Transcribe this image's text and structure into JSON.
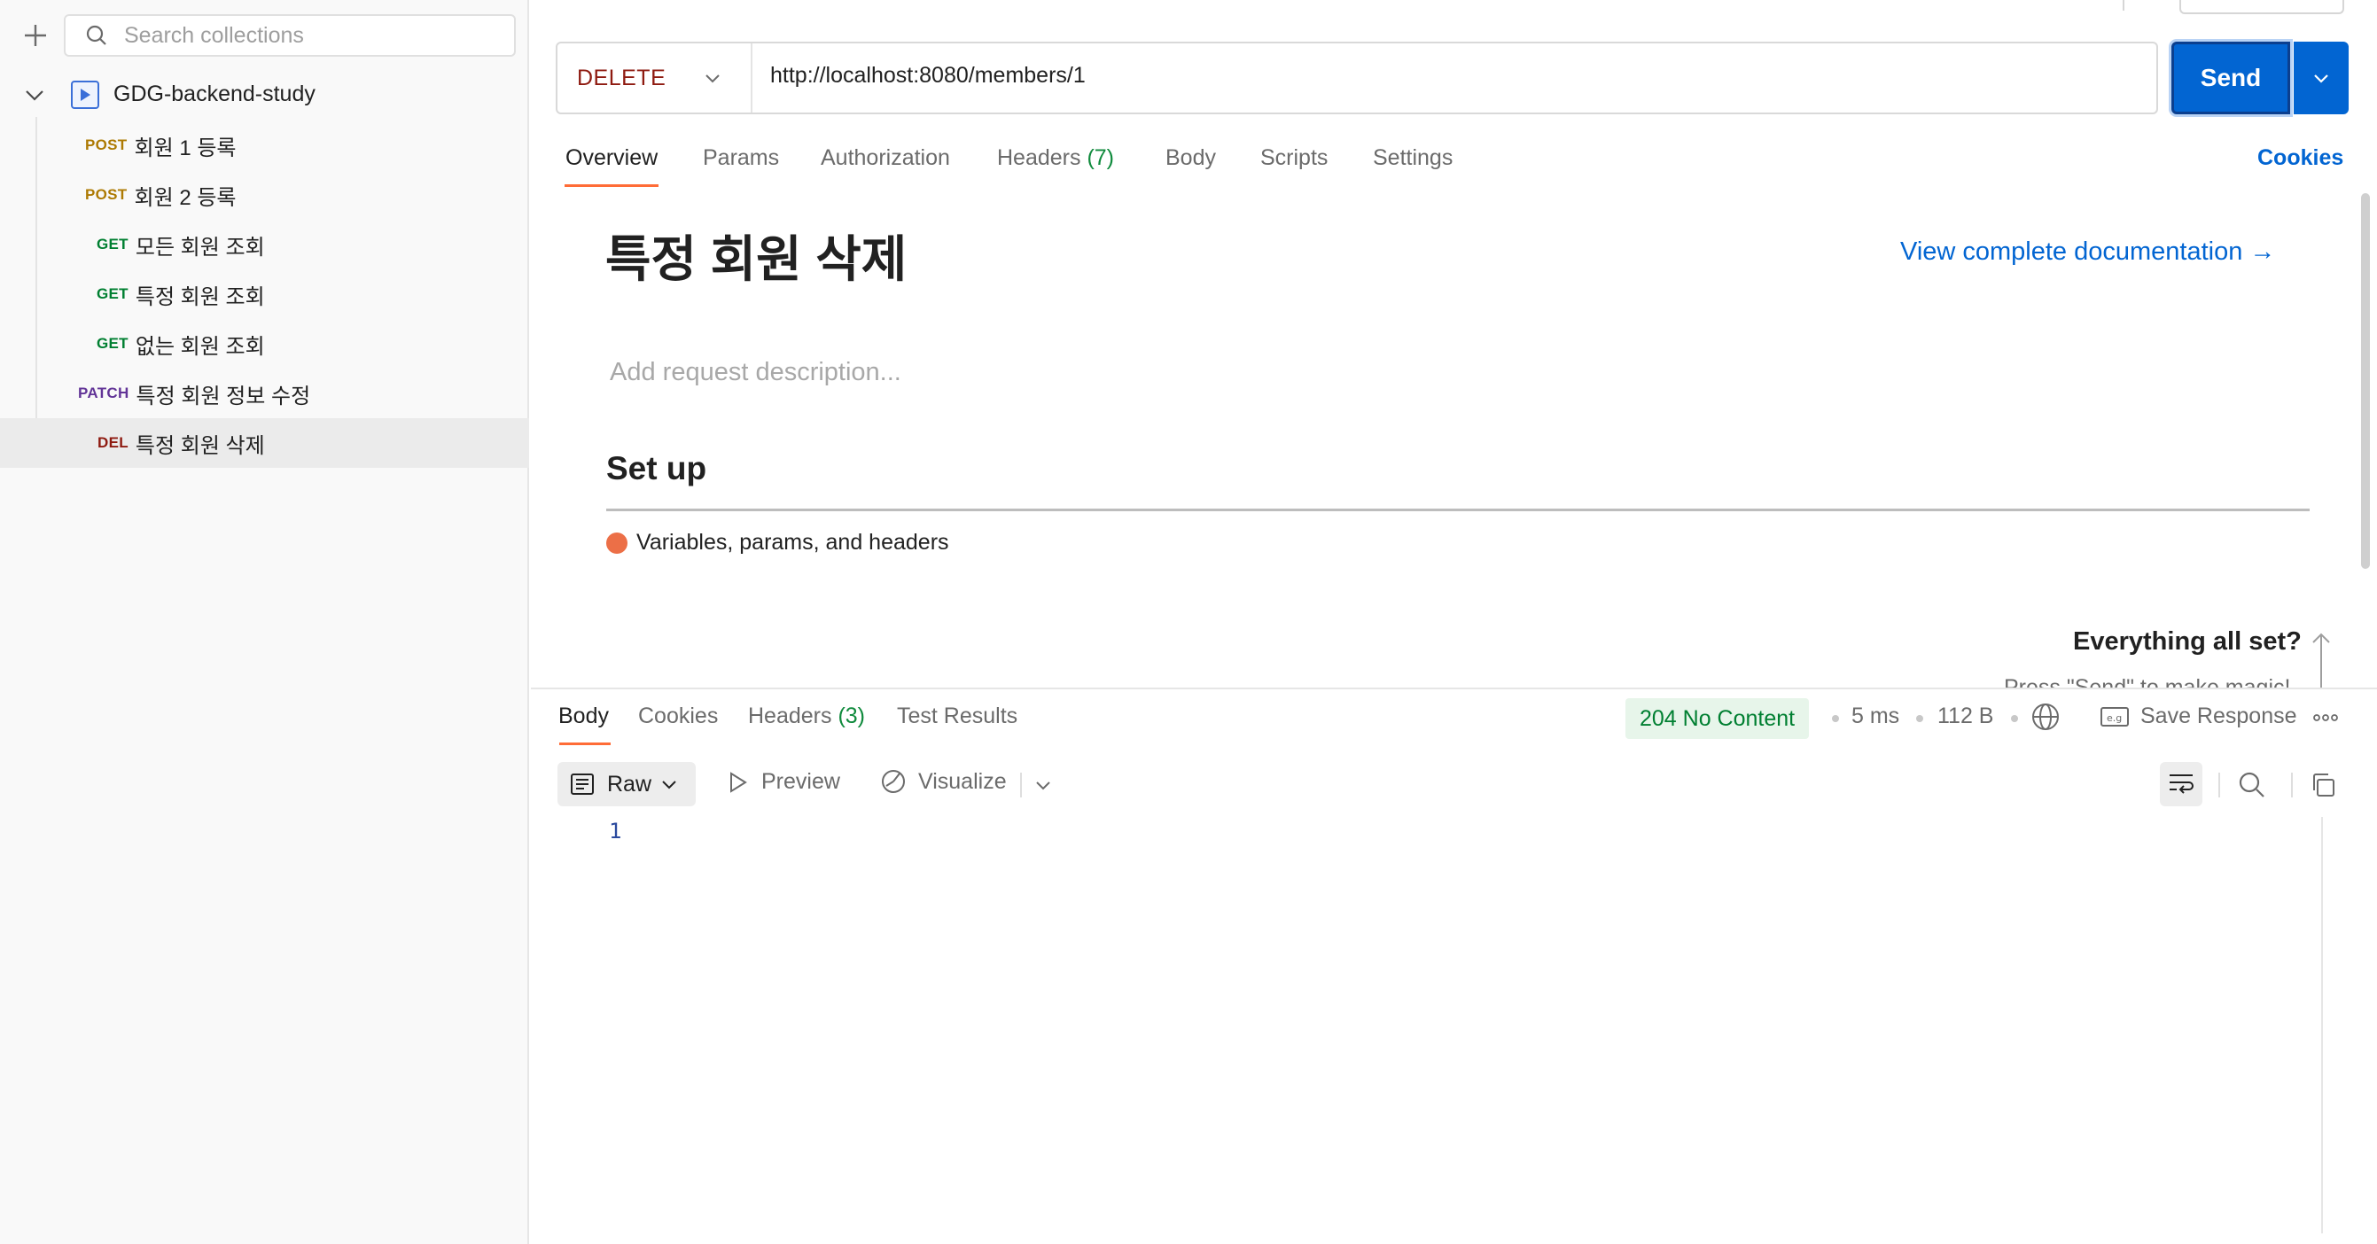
{
  "sidebar": {
    "search_placeholder": "Search collections",
    "collection_name": "GDG-backend-study",
    "requests": [
      {
        "method": "POST",
        "name": "회원 1 등록"
      },
      {
        "method": "POST",
        "name": "회원 2 등록"
      },
      {
        "method": "GET",
        "name": "모든 회원 조회"
      },
      {
        "method": "GET",
        "name": "특정 회원 조회"
      },
      {
        "method": "GET",
        "name": "없는 회원 조회"
      },
      {
        "method": "PATCH",
        "name": "특정 회원 정보 수정"
      },
      {
        "method": "DEL",
        "name": "특정 회원 삭제"
      }
    ]
  },
  "request": {
    "method": "DELETE",
    "url": "http://localhost:8080/members/1",
    "send_label": "Send"
  },
  "tabs": {
    "overview": "Overview",
    "params": "Params",
    "authorization": "Authorization",
    "headers": "Headers",
    "headers_count": "(7)",
    "body": "Body",
    "scripts": "Scripts",
    "settings": "Settings",
    "cookies": "Cookies"
  },
  "doc": {
    "title": "특정 회원 삭제",
    "view_docs": "View complete documentation →",
    "description_placeholder": "Add request description...",
    "setup_title": "Set up",
    "setup_item": "Variables, params, and headers",
    "all_set": "Everything all set?",
    "press_send": "Press \"Send\" to make magic!"
  },
  "response": {
    "tabs": {
      "body": "Body",
      "cookies": "Cookies",
      "headers": "Headers",
      "headers_count": "(3)",
      "test_results": "Test Results"
    },
    "status": "204 No Content",
    "time": "5 ms",
    "size": "112 B",
    "save_response": "Save Response",
    "format": "Raw",
    "preview": "Preview",
    "visualize": "Visualize",
    "line_number": "1"
  },
  "colors": {
    "accent": "#ff6c37",
    "send": "#0265d2",
    "delete": "#8e1a10",
    "get": "#007f31",
    "post": "#ad7a03",
    "patch": "#623497"
  }
}
